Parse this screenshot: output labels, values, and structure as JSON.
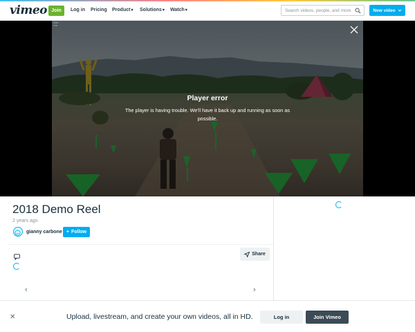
{
  "header": {
    "logo": "vimeo",
    "join_label": "Join",
    "nav": [
      {
        "label": "Log in"
      },
      {
        "label": "Pricing"
      },
      {
        "label": "Product"
      },
      {
        "label": "Solutions"
      },
      {
        "label": "Watch"
      }
    ],
    "search_placeholder": "Search videos, people, and more",
    "new_video_label": "New video"
  },
  "player": {
    "error_title": "Player error",
    "error_message": "The player is having trouble. We'll have it back up and running as soon as possible."
  },
  "video": {
    "title": "2018 Demo Reel",
    "posted": "2 years ago",
    "author": "gianny carbone",
    "follow_label": "Follow",
    "share_label": "Share"
  },
  "banner": {
    "text": "Upload, livestream, and create your own videos, all in HD.",
    "login_label": "Log in",
    "join_label": "Join Vimeo"
  },
  "colors": {
    "accent": "#00adef",
    "join_green": "#6ab42d",
    "dark_button": "#3b4b56"
  }
}
